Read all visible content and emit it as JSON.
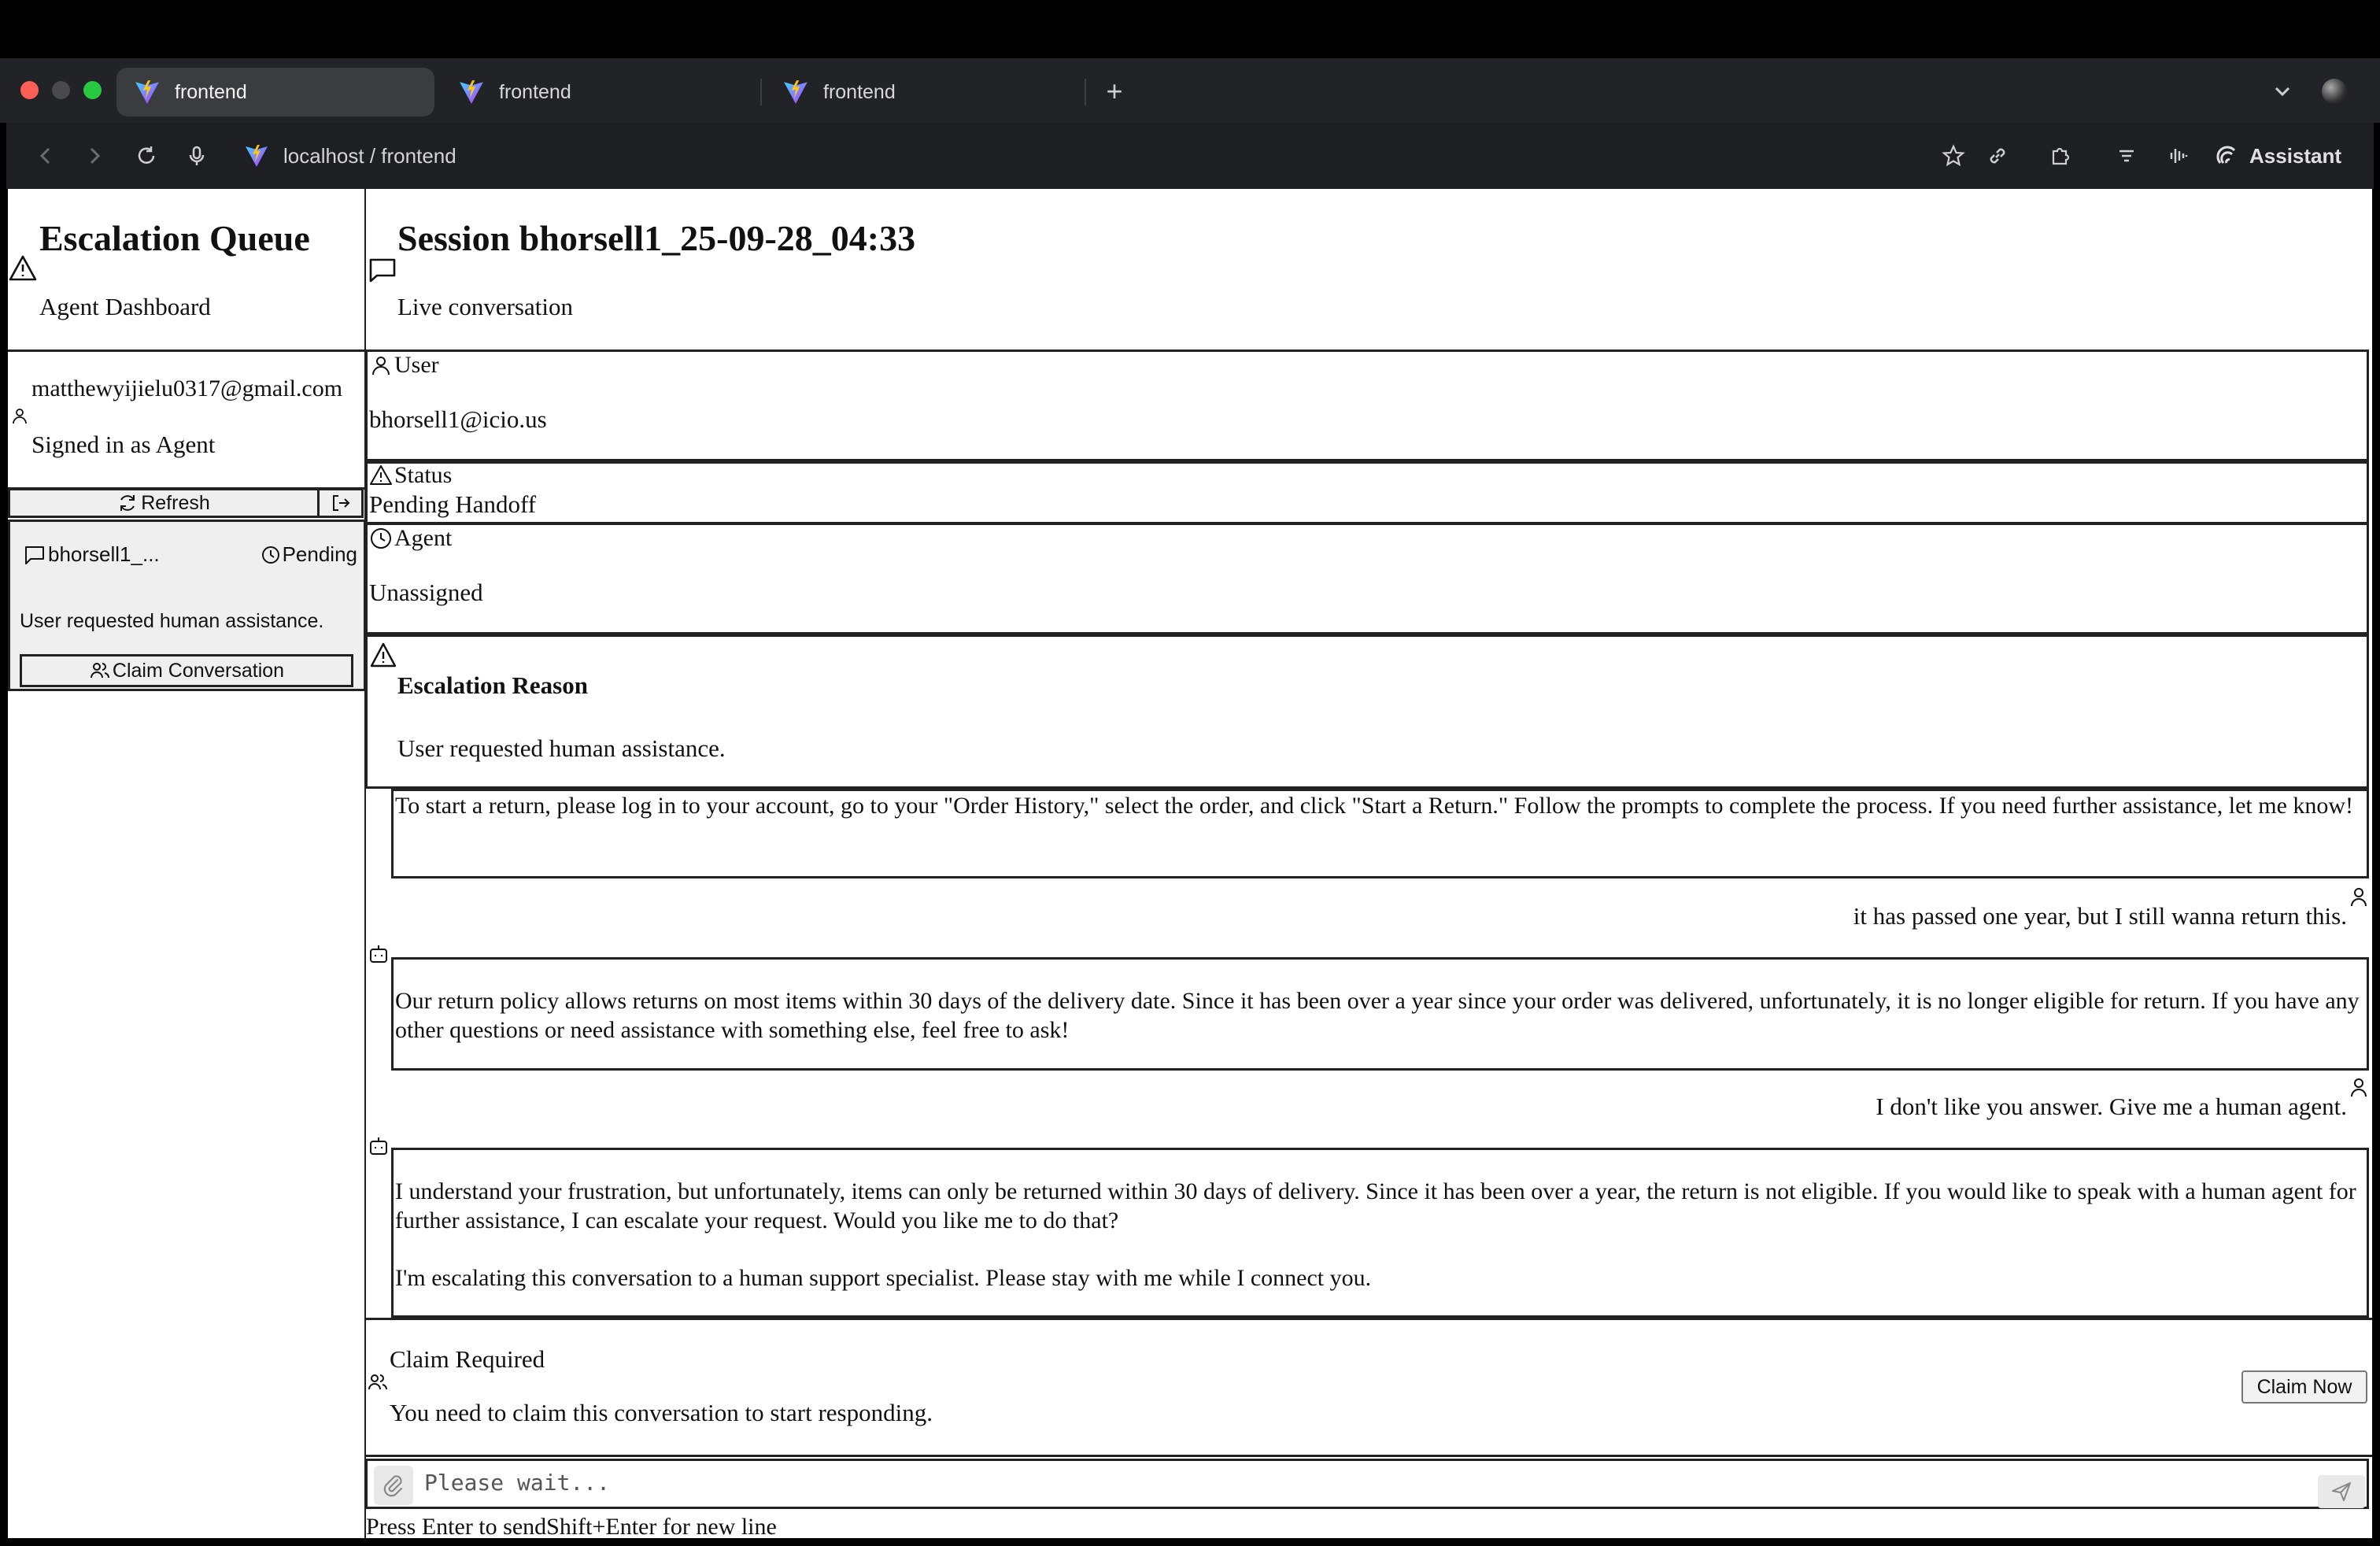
{
  "browser": {
    "tabs": [
      {
        "label": "frontend",
        "active": true
      },
      {
        "label": "frontend",
        "active": false
      },
      {
        "label": "frontend",
        "active": false
      }
    ],
    "url": "localhost / frontend",
    "assistant_label": "Assistant"
  },
  "sidebar": {
    "title": "Escalation Queue",
    "subtitle": "Agent Dashboard",
    "user_email": "matthewyijielu0317@gmail.com",
    "user_role": "Signed in as Agent",
    "refresh_label": "Refresh",
    "conversations": [
      {
        "name": "bhorsell1_...",
        "status": "Pending",
        "reason": "User requested human assistance.",
        "claim_label": "Claim Conversation"
      }
    ]
  },
  "session": {
    "title": "Session bhorsell1_25-09-28_04:33",
    "subtitle": "Live conversation",
    "user_label": "User",
    "user_value": "bhorsell1@icio.us",
    "status_label": "Status",
    "status_value": "Pending Handoff",
    "agent_label": "Agent",
    "agent_value": "Unassigned",
    "escalation_title": "Escalation Reason",
    "escalation_text": "User requested human assistance."
  },
  "messages": [
    {
      "role": "bot",
      "text": "To start a return, please log in to your account, go to your \"Order History,\" select the order, and click \"Start a Return.\" Follow the prompts to complete the process. If you need further assistance, let me know!"
    },
    {
      "role": "user",
      "text": "it has passed one year, but I still wanna return this."
    },
    {
      "role": "bot",
      "text": "Our return policy allows returns on most items within 30 days of the delivery date. Since it has been over a year since your order was delivered, unfortunately, it is no longer eligible for return. If you have any other questions or need assistance with something else, feel free to ask!"
    },
    {
      "role": "user",
      "text": "I don't like you answer. Give me a human agent."
    },
    {
      "role": "bot",
      "text": "I understand your frustration, but unfortunately, items can only be returned within 30 days of delivery. Since it has been over a year, the return is not eligible. If you would like to speak with a human agent for further assistance, I can escalate your request. Would you like me to do that?",
      "text2": "I'm escalating this conversation to a human support specialist. Please stay with me while I connect you."
    }
  ],
  "claim": {
    "title": "Claim Required",
    "text": "You need to claim this conversation to start responding.",
    "button": "Claim Now"
  },
  "composer": {
    "placeholder": "Please wait...",
    "hint": "Press Enter to sendShift+Enter for new line"
  },
  "icons": {
    "tab_logo": "vite-logo-icon",
    "back": "arrow-left-icon",
    "forward": "arrow-right-icon",
    "reload": "reload-icon",
    "mic": "microphone-icon",
    "bookmark": "star-icon",
    "link": "link-icon",
    "extensions": "puzzle-icon",
    "reader": "menu-lines-icon",
    "audio": "waveform-icon"
  },
  "colors": {
    "chrome_bg": "#222326",
    "active_tab": "#3b3c40",
    "card_bg": "#efefef",
    "border": "#222222"
  }
}
